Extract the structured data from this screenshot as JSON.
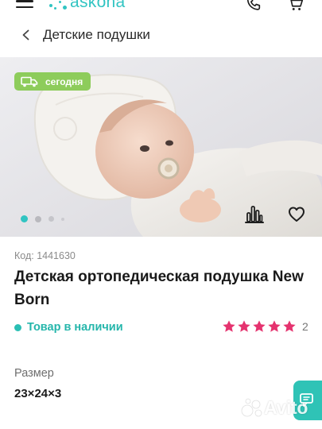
{
  "header": {
    "logo_text": "askona",
    "menu_icon": "hamburger-menu-icon",
    "phone_icon": "phone-icon",
    "cart_icon": "cart-icon",
    "brand_color": "#31c4c2"
  },
  "breadcrumb": {
    "back_icon": "chevron-left-icon",
    "label": "Детские подушки"
  },
  "gallery": {
    "badge_icon": "delivery-van-icon",
    "badge_text": "сегодня",
    "badge_color": "#8dcc5b",
    "slide_count": 4,
    "active_slide": 1,
    "compare_icon": "compare-bars-icon",
    "favorite_icon": "heart-icon",
    "image_alt": "baby-on-orthopedic-pillow-photo"
  },
  "product": {
    "code": "Код: 1441630",
    "title": "Детская ортопедическая подушка New Born",
    "availability": "Товар в наличии",
    "availability_color": "#25b6ab",
    "rating_stars": 5,
    "rating_max": 5,
    "reviews_count": "2",
    "star_color": "#e5336f"
  },
  "size": {
    "label": "Размер",
    "value": "23×24×3"
  },
  "chat": {
    "icon": "chat-icon",
    "color": "#2fc3b6"
  },
  "watermark": {
    "text": "Avito",
    "icon": "avito-dots-icon"
  }
}
